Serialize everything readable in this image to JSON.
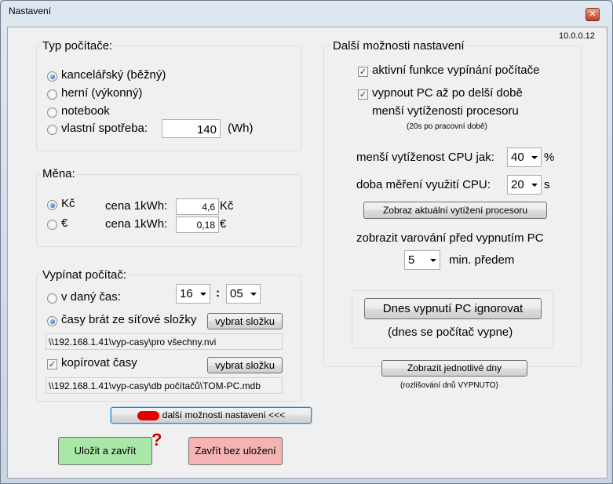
{
  "window": {
    "title": "Nastavení",
    "close_glyph": "✕",
    "version": "10.0.0.12"
  },
  "typ": {
    "title": "Typ počítače:",
    "options": [
      "kancelářský (běžný)",
      "herní (výkonný)",
      "notebook",
      "vlastní spotřeba:"
    ],
    "selected": 0,
    "consumption_value": "140",
    "consumption_unit": "(Wh)"
  },
  "mena": {
    "title": "Měna:",
    "rows": [
      {
        "currency": "Kč",
        "price_label": "cena 1kWh:",
        "value": "4,6",
        "unit": "Kč",
        "selected": true
      },
      {
        "currency": "€",
        "price_label": "cena 1kWh:",
        "value": "0,18",
        "unit": "€",
        "selected": false
      }
    ]
  },
  "vypinat": {
    "title": "Vypínat počítač:",
    "opt_time": "v daný čas:",
    "hour": "16",
    "colon": ":",
    "minute": "05",
    "opt_network": "časy brát ze síťové složky",
    "select_folder": "vybrat složku",
    "network_path": "\\\\192.168.1.41\\vyp-casy\\pro všechny.nvi",
    "copy_label": "kopírovat časy",
    "select_folder2": "vybrat složku",
    "copy_path": "\\\\192.168.1.41\\vyp-casy\\db počítačů\\TOM-PC.mdb"
  },
  "dalsi": {
    "title": "Další možnosti nastavení",
    "check1": "aktivní funkce vypínání počítače",
    "check2_line1": "vypnout PC až po delší době",
    "check2_line2": "menší vytíženosti procesoru",
    "check2_note": "(20s po pracovní době)",
    "cpu_label": "menší vytíženost CPU jak:",
    "cpu_value": "40",
    "cpu_unit": "%",
    "measure_label": "doba měření využití CPU:",
    "measure_value": "20",
    "measure_unit": "s",
    "show_cpu_btn": "Zobraz aktuální vytížení procesoru",
    "warn_label": "zobrazit varování před vypnutím PC",
    "warn_value": "5",
    "warn_unit": "min. předem",
    "ignore_btn": "Dnes vypnutí PC ignorovat",
    "ignore_status": "(dnes se počítač vypne)",
    "days_btn": "Zobrazit jednotlivé dny",
    "days_note": "(rozlišování dnů VYPNUTO)"
  },
  "bottom": {
    "more_btn": "další možnosti nastavení <<<",
    "save_btn": "Uložit a zavřít",
    "question_mark": "?",
    "nosave_btn": "Zavřít bez uložení"
  },
  "colors": {
    "save_bg": "#a9e7a9",
    "nosave_bg": "#f5b3b3",
    "redact": "#e00000",
    "question": "#cc0000"
  }
}
